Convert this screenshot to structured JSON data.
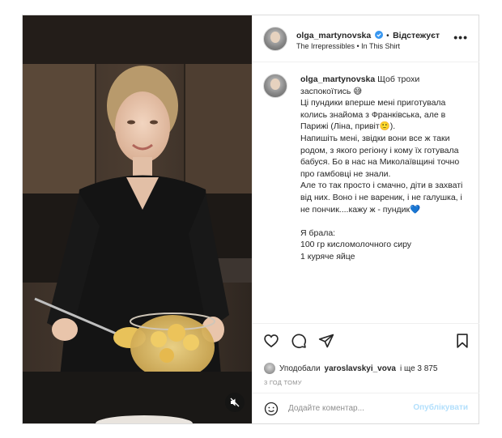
{
  "post": {
    "username": "olga_martynovska",
    "follow_label": "Відстежуєт",
    "audio_subtitle": "The Irrepressibles • In This Shirt",
    "more_label": "•••"
  },
  "caption": {
    "username": "olga_martynovska",
    "text": " Щоб трохи заспокоїтись 😅\nЦі пундики вперше мені приготувала колись знайома з Франківська, але в Парижі (Ліна, привіт🙂).\nНапишіть мені, звідки вони все ж таки родом, з якого регіону і кому їх готувала бабуся. Бо в нас на Миколаївщині точно про гамбовці не знали.\nАле то так просто і смачно, діти в захваті від них. Воно і не вареник, і не галушка, і не пончик....кажу ж - пундик💙\n\nЯ брала:\n100 гр кисломолочного сиру\n1 куряче яйце"
  },
  "likes": {
    "prefix": "Уподобали",
    "user": "yaroslavskyi_vova",
    "suffix": "і ще 3 875"
  },
  "time_ago": "3 ГОД ТОМУ",
  "comment": {
    "placeholder": "Додайте коментар...",
    "publish_label": "Опублікувати"
  },
  "icons": {
    "like": "heart-icon",
    "comment": "comment-icon",
    "share": "send-icon",
    "save": "bookmark-icon",
    "emoji": "smiley-icon",
    "mute": "speaker-muted-icon",
    "verified": "verified-badge-icon"
  },
  "colors": {
    "verified": "#3897f0",
    "publish_disabled": "#b2dffc",
    "muted_text": "#8e8e8e"
  }
}
